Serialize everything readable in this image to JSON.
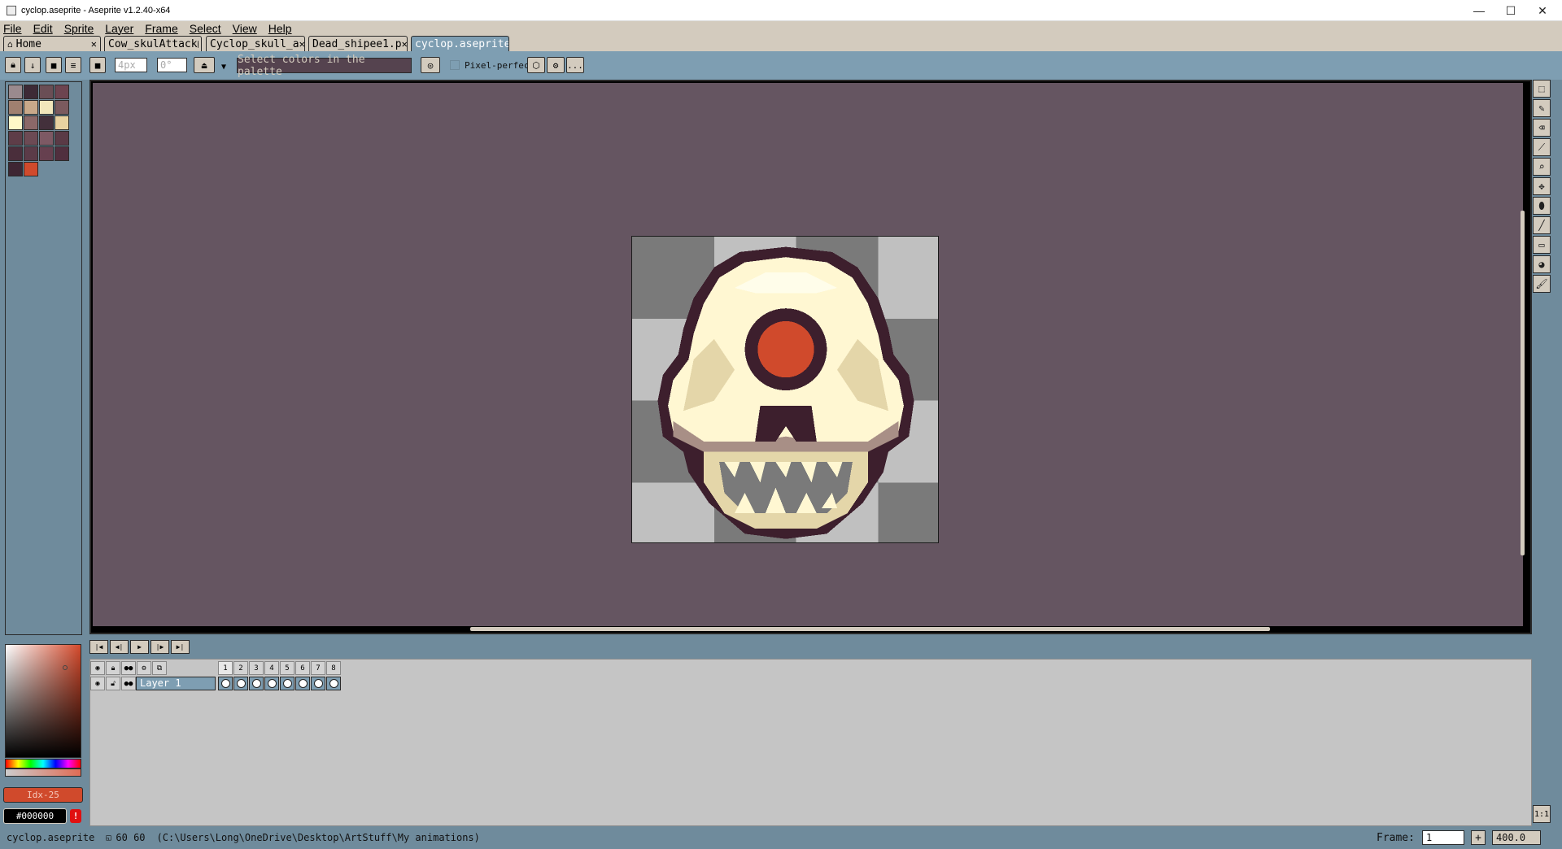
{
  "window": {
    "title": "cyclop.aseprite - Aseprite v1.2.40-x64",
    "controls": [
      "—",
      "☐",
      "✕"
    ]
  },
  "menu": [
    "File",
    "Edit",
    "Sprite",
    "Layer",
    "Frame",
    "Select",
    "View",
    "Help"
  ],
  "tabs": [
    {
      "label": "Home",
      "icon": "home-icon",
      "state": "close"
    },
    {
      "label": "Cow_skulAttack",
      "state": "modified"
    },
    {
      "label": "Cyclop_skull_a",
      "state": "close"
    },
    {
      "label": "Dead_shipee1.p",
      "state": "close"
    },
    {
      "label": "cyclop.aseprite",
      "state": "modified",
      "active": true
    }
  ],
  "context_bar": {
    "brush_size": "4px",
    "brush_angle": "0°",
    "palette_hint": "Select colors in the palette",
    "pixel_perfect_label": "Pixel-perfect",
    "more_label": "..."
  },
  "palette_panel": {
    "colors": [
      [
        "#9a8a8e",
        "#3d2a36",
        "#6a4e55",
        "#6d4450"
      ],
      [
        "#a08070",
        "#c9a98a",
        "#f1e6bb",
        "#7b5a5e"
      ],
      [
        "#fff8c8",
        "#8b6868",
        "#43303b",
        "#e8d2a0"
      ],
      [
        "#5e3d48",
        "#6c4a54",
        "#7d5964",
        "#5a3a46"
      ],
      [
        "#4a2e3b",
        "#5b3b48",
        "#66404f",
        "#502f3e"
      ],
      [
        "#3e2633",
        "#d04a2c"
      ]
    ]
  },
  "color_panel": {
    "fg_label": "Idx-25",
    "fg_color": "#d04a2c",
    "bg_label": "#000000",
    "bg_color": "#000000",
    "warning": "!"
  },
  "timeline": {
    "layer_name": "Layer 1",
    "frames": [
      "1",
      "2",
      "3",
      "4",
      "5",
      "6",
      "7",
      "8"
    ],
    "current_frame": "1"
  },
  "status": {
    "filename": "cyclop.aseprite",
    "size": "60 60",
    "path": "(C:\\Users\\Long\\OneDrive\\Desktop\\ArtStuff\\My animations)",
    "frame_label": "Frame:",
    "frame_value": "1",
    "zoom": "400.0"
  },
  "tools": [
    "select-icon",
    "pencil-icon",
    "eraser-icon",
    "eyedropper-icon",
    "zoom-icon",
    "move-icon",
    "fill-icon",
    "line-icon",
    "rectangle-icon",
    "blur-icon",
    "brush-icon"
  ],
  "canvas": {
    "bg_color": "#655561",
    "checker_dark": "#7a7a7a",
    "checker_light": "#c0c0c0"
  },
  "sprite_colors": {
    "outline": "#3d1f2d",
    "bone_light": "#fff7d2",
    "bone_mid": "#e4d6a9",
    "bone_shadow": "#a88f86",
    "eye": "#d04a2c"
  }
}
